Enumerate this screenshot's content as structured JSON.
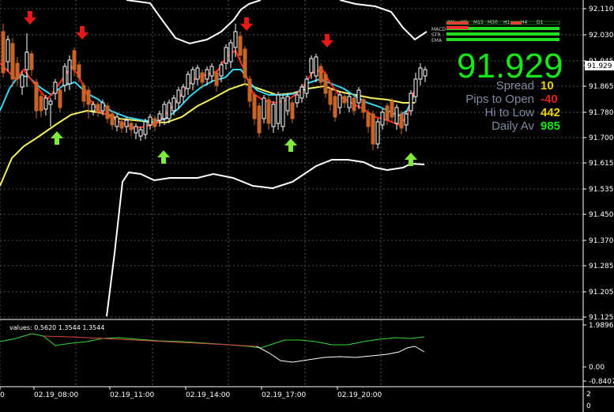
{
  "price_axis": {
    "labels": [
      "92.110",
      "92.030",
      "91.945",
      "91.865",
      "91.780",
      "91.700",
      "91.615",
      "91.535",
      "91.450",
      "91.370",
      "91.285",
      "91.205",
      "91.125"
    ],
    "current": "91.929"
  },
  "time_axis": {
    "labels": [
      "0",
      "02.19_08:00",
      "02.19_11:00",
      "02.19_14:00",
      "02.19_17:00",
      "02.19_20:00"
    ]
  },
  "indicator_panel": {
    "caption": "values: 0.5620 1.3544 1.3544",
    "axis_labels": [
      "1.9896",
      "0.00",
      "-0.8407"
    ]
  },
  "bottom_right_digits": [
    "2",
    "0"
  ],
  "info": {
    "big_price": "91.929",
    "rows": [
      {
        "label": "Spread",
        "value": "10",
        "color": "#f0d000"
      },
      {
        "label": "Pips to Open",
        "value": "-40",
        "color": "#e02020"
      },
      {
        "label": "Hi to Low",
        "value": "442",
        "color": "#f0d000"
      },
      {
        "label": "Daily Av",
        "value": "985",
        "color": "#19e619"
      }
    ]
  },
  "trend_table": {
    "timeframes": [
      "M1",
      "M5",
      "M15",
      "M30",
      "H1",
      "H4",
      "D1"
    ],
    "rows": [
      "MACD",
      "STR",
      "EMA"
    ]
  },
  "colors": {
    "bull_candle": "#ffffff",
    "bear_candle": "#c86428",
    "ma_fast": "#ff2a1a",
    "ma_mid": "#38d4f0",
    "ma_slow": "#f4f060",
    "band": "#ffffff",
    "arrow_up": "#7dea3c",
    "arrow_down": "#e81818",
    "osc_main": "#33dd33",
    "osc_signal": "#dd4444"
  }
}
